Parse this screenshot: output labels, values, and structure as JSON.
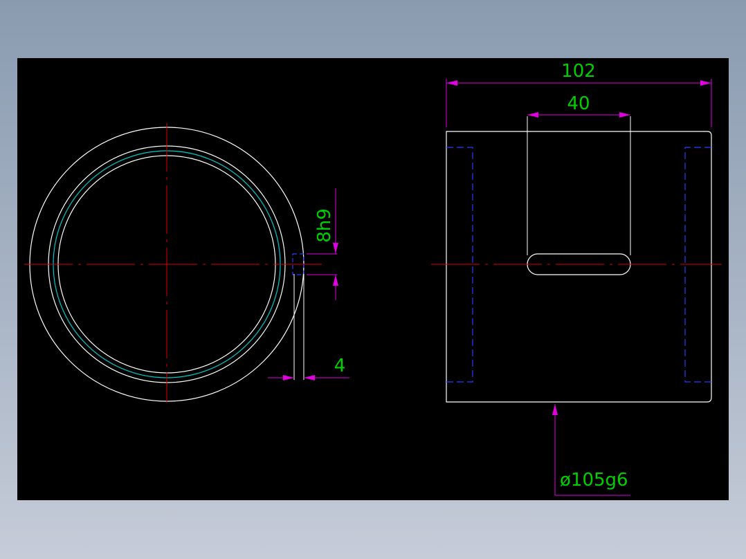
{
  "colors": {
    "background": "#000000",
    "outline": "#ffffff",
    "centerline": "#e00000",
    "dimension": "#e000e0",
    "dimension_text": "#00d000",
    "hidden_line": "#2040ff",
    "thread": "#00c8c8"
  },
  "dimensions": {
    "overall_length": "102",
    "slot_length": "40",
    "keyway_width": "8h9",
    "keyway_depth": "4",
    "outer_diameter": "ø105g6"
  }
}
